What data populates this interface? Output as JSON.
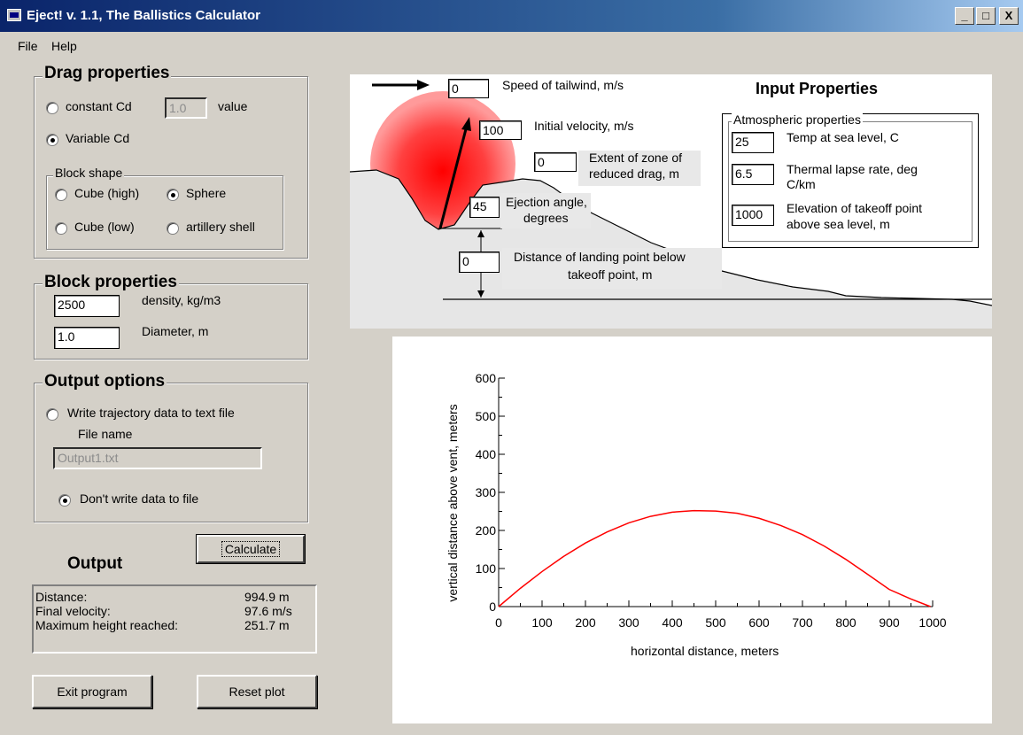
{
  "window": {
    "title": "Eject! v. 1.1, The Ballistics Calculator",
    "min_btn": "_",
    "max_btn": "□",
    "close_btn": "X"
  },
  "menu": {
    "file": "File",
    "help": "Help"
  },
  "drag": {
    "legend": "Drag properties",
    "constant_label": "constant Cd",
    "constant_value": "1.0",
    "value_label": "value",
    "variable_label": "Variable Cd",
    "selected": "variable",
    "shape": {
      "legend": "Block shape",
      "cube_high": "Cube (high)",
      "sphere": "Sphere",
      "cube_low": "Cube (low)",
      "shell": "artillery shell",
      "selected": "sphere"
    }
  },
  "block": {
    "legend": "Block properties",
    "density_value": "2500",
    "density_label": "density, kg/m3",
    "diameter_value": "1.0",
    "diameter_label": "Diameter, m"
  },
  "output_options": {
    "legend": "Output options",
    "write_label": "Write trajectory data to text file",
    "file_name_label": "File name",
    "file_name_value": "Output1.txt",
    "dont_write_label": "Don't write data to file",
    "selected": "dont_write"
  },
  "buttons": {
    "calculate": "Calculate",
    "exit": "Exit program",
    "reset": "Reset plot"
  },
  "output": {
    "title": "Output",
    "rows": [
      {
        "label": "Distance:",
        "value": "994.9 m"
      },
      {
        "label": "Final velocity:",
        "value": "97.6 m/s"
      },
      {
        "label": "Maximum height reached:",
        "value": "251.7 m"
      }
    ]
  },
  "input_props": {
    "title": "Input Properties",
    "tailwind_value": "0",
    "tailwind_label": "Speed of tailwind, m/s",
    "velocity_value": "100",
    "velocity_label": "Initial velocity, m/s",
    "zone_value": "0",
    "zone_label_1": "Extent of zone of",
    "zone_label_2": "reduced drag, m",
    "angle_value": "45",
    "angle_label_1": "Ejection angle,",
    "angle_label_2": "degrees",
    "landing_value": "0",
    "landing_label_1": "Distance of landing point below",
    "landing_label_2": "takeoff point, m",
    "atmos": {
      "legend": "Atmospheric properties",
      "temp_value": "25",
      "temp_label": "Temp at sea level, C",
      "lapse_value": "6.5",
      "lapse_label_1": "Thermal lapse rate, deg",
      "lapse_label_2": "C/km",
      "elev_value": "1000",
      "elev_label_1": "Elevation of takeoff point",
      "elev_label_2": "above sea level, m"
    }
  },
  "colors": {
    "trajectory": "#ff0000",
    "ground": "#e6e6e6",
    "window_bg": "#d4d0c8",
    "titlebar": "#0a246a"
  },
  "chart_data": {
    "type": "line",
    "xlabel": "horizontal distance, meters",
    "ylabel": "vertical distance above vent, meters",
    "xlim": [
      0,
      1000
    ],
    "ylim": [
      0,
      600
    ],
    "xticks": [
      0,
      100,
      200,
      300,
      400,
      500,
      600,
      700,
      800,
      900,
      1000
    ],
    "yticks": [
      0,
      100,
      200,
      300,
      400,
      500,
      600
    ],
    "series": [
      {
        "x": [
          0,
          50,
          100,
          150,
          200,
          250,
          300,
          350,
          400,
          450,
          500,
          550,
          600,
          650,
          700,
          750,
          800,
          850,
          900,
          950,
          995
        ],
        "y": [
          0,
          48,
          92,
          132,
          167,
          196,
          220,
          237,
          248,
          252,
          251,
          245,
          232,
          213,
          189,
          159,
          124,
          85,
          45,
          20,
          0
        ]
      }
    ]
  }
}
